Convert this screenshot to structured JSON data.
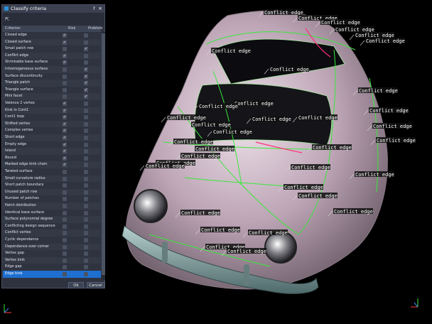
{
  "dialog": {
    "title": "Classify criteria",
    "help": "?",
    "close": "×",
    "columns": {
      "criterion": "Criterion",
      "risk": "Risk",
      "problem": "Problem"
    },
    "ok_label": "Ok",
    "cancel_label": "Cancel",
    "rows": [
      {
        "name": "Closed edge",
        "risk": true,
        "problem": false
      },
      {
        "name": "Closed surface",
        "risk": true,
        "problem": false
      },
      {
        "name": "Small patch row",
        "risk": false,
        "problem": true
      },
      {
        "name": "Conflict edge",
        "risk": true,
        "problem": false
      },
      {
        "name": "Shrinkable base surface",
        "risk": true,
        "problem": false
      },
      {
        "name": "Inhomogeneous surface",
        "risk": false,
        "problem": true
      },
      {
        "name": "Surface discontinuity",
        "risk": false,
        "problem": true
      },
      {
        "name": "Triangle patch",
        "risk": false,
        "problem": true
      },
      {
        "name": "Triangle surface",
        "risk": false,
        "problem": true
      },
      {
        "name": "Mini facet",
        "risk": false,
        "problem": true
      },
      {
        "name": "Valence 2 vertex",
        "risk": true,
        "problem": false
      },
      {
        "name": "Kink in Cont1",
        "risk": true,
        "problem": false
      },
      {
        "name": "Cont1 loop",
        "risk": true,
        "problem": false
      },
      {
        "name": "Shifted vertex",
        "risk": true,
        "problem": false
      },
      {
        "name": "Complex vertex",
        "risk": true,
        "problem": false
      },
      {
        "name": "Short edge",
        "risk": true,
        "problem": false
      },
      {
        "name": "Empty edge",
        "risk": true,
        "problem": false
      },
      {
        "name": "Island",
        "risk": true,
        "problem": false
      },
      {
        "name": "Bound",
        "risk": true,
        "problem": false
      },
      {
        "name": "Marked edge kink chain",
        "risk": true,
        "problem": false
      },
      {
        "name": "Twisted surface",
        "risk": false,
        "problem": false
      },
      {
        "name": "Small curvature radius",
        "risk": false,
        "problem": false
      },
      {
        "name": "Short patch boundary",
        "risk": false,
        "problem": false
      },
      {
        "name": "Unused patch row",
        "risk": false,
        "problem": false
      },
      {
        "name": "Number of patches",
        "risk": false,
        "problem": false
      },
      {
        "name": "Patch distribution",
        "risk": false,
        "problem": false
      },
      {
        "name": "Identical base surface",
        "risk": false,
        "problem": false
      },
      {
        "name": "Surface polynomial degree",
        "risk": false,
        "problem": false
      },
      {
        "name": "Conflicting design sequence",
        "risk": false,
        "problem": false
      },
      {
        "name": "Conflict vertex",
        "risk": false,
        "problem": false
      },
      {
        "name": "Cyclic dependance",
        "risk": false,
        "problem": false
      },
      {
        "name": "Dependance over corner",
        "risk": false,
        "problem": false
      },
      {
        "name": "Vertex gap",
        "risk": false,
        "problem": false
      },
      {
        "name": "Vertex kink",
        "risk": false,
        "problem": false
      },
      {
        "name": "Edge gap",
        "risk": false,
        "problem": false
      },
      {
        "name": "Edge kink",
        "risk": false,
        "problem": false,
        "selected": true
      }
    ]
  },
  "viewport": {
    "conflict_label": "Conflict edge",
    "colors": {
      "surface": "#c9b3c1",
      "lines": "#39e83b",
      "highlight": "#ff2f7a",
      "label_bg": "#111111"
    }
  }
}
